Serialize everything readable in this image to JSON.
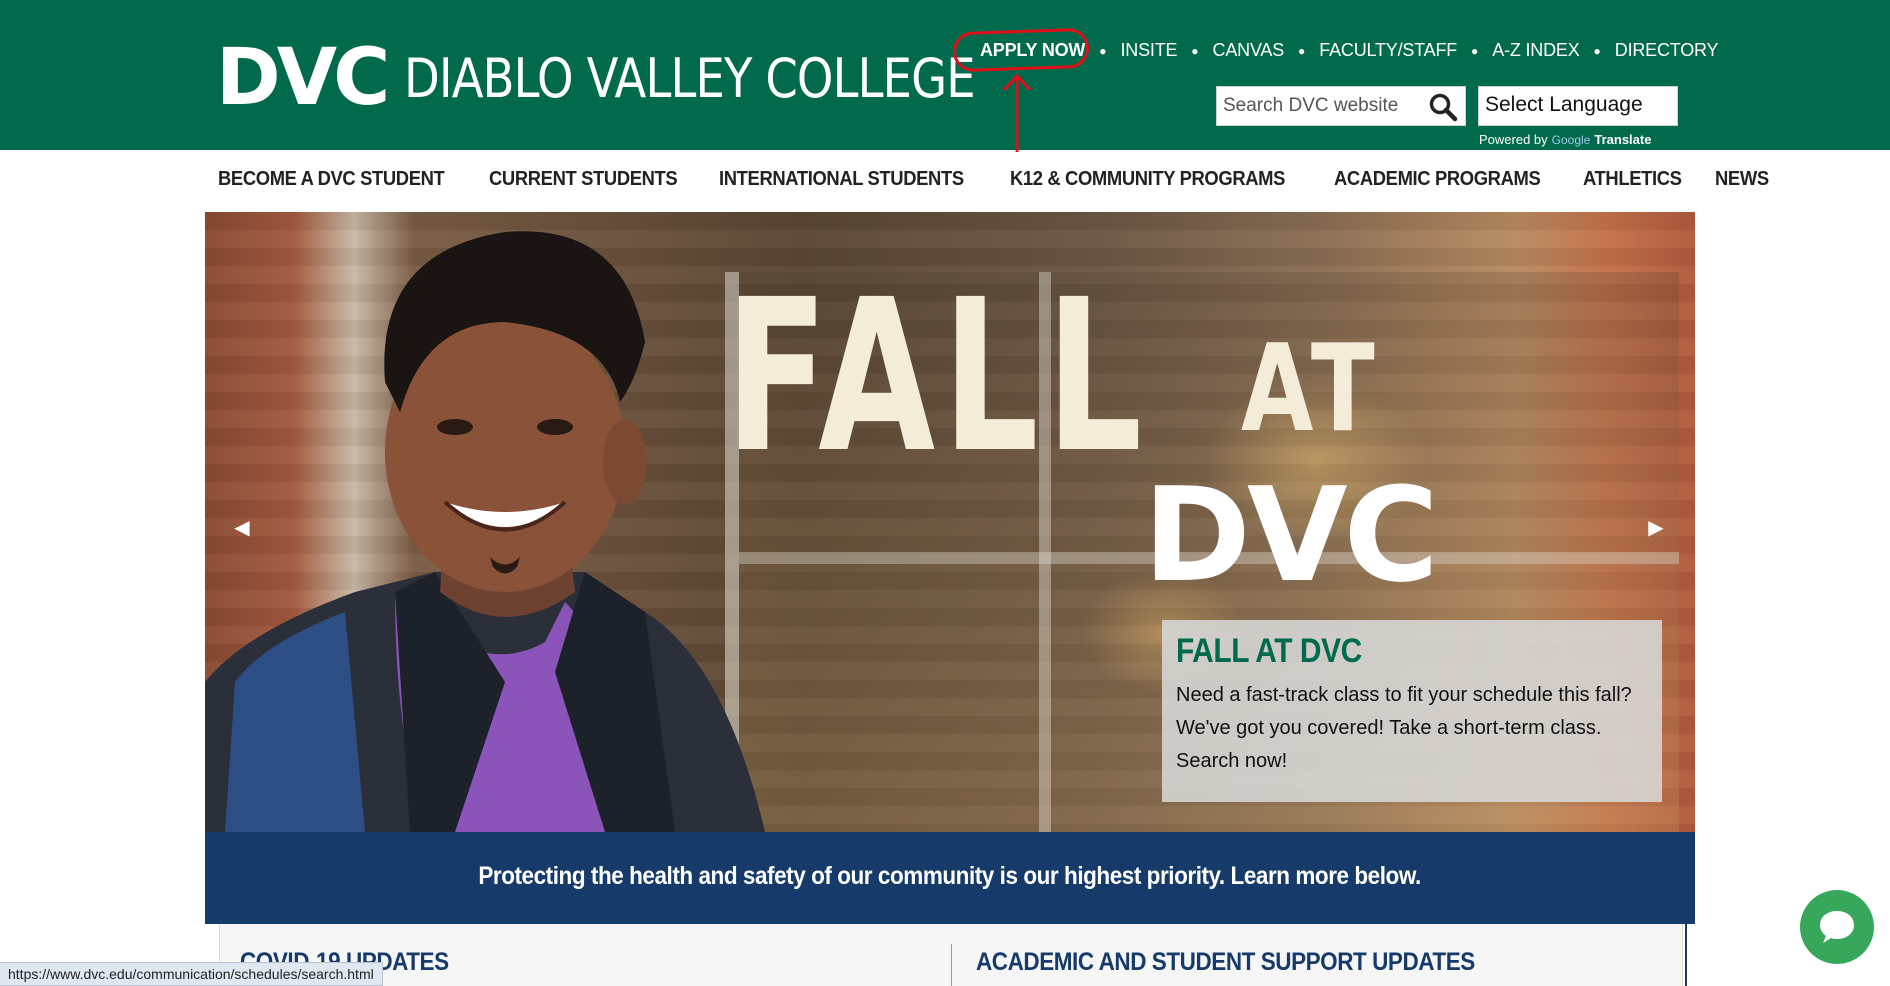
{
  "header": {
    "logo_mark": "DVC",
    "logo_name": "DIABLO VALLEY COLLEGE",
    "bg_color": "#016a4d",
    "utility_links": [
      "APPLY NOW",
      "INSITE",
      "CANVAS",
      "FACULTY/STAFF",
      "A-Z INDEX",
      "DIRECTORY"
    ],
    "search": {
      "placeholder": "Search DVC website",
      "icon": "search-icon"
    },
    "language_select": "Select Language",
    "powered_by": {
      "prefix": "Powered by",
      "google": "Google",
      "translate": "Translate"
    }
  },
  "nav": {
    "items": [
      "BECOME A DVC STUDENT",
      "CURRENT STUDENTS",
      "INTERNATIONAL STUDENTS",
      "K12 & COMMUNITY PROGRAMS",
      "ACADEMIC PROGRAMS",
      "ATHLETICS",
      "NEWS"
    ]
  },
  "hero": {
    "headline_fall": "FALL",
    "headline_at": "AT",
    "headline_dvc": "DVC",
    "caption_title": "FALL AT DVC",
    "caption_text": "Need a fast-track class to fit your schedule this fall? We've got you covered! Take a short-term class. Search now!",
    "prev_icon": "triangle-left-icon",
    "next_icon": "triangle-right-icon"
  },
  "banner": {
    "text": "Protecting the health and safety of our community is our highest priority. Learn more below.",
    "bg_color": "#163b6b"
  },
  "panels": {
    "left_title": "COVID-19 UPDATES",
    "right_title": "ACADEMIC AND STUDENT SUPPORT UPDATES"
  },
  "annotation": {
    "color": "#e0101a"
  },
  "chat": {
    "icon": "chat-bubble-icon",
    "color": "#37a85b"
  },
  "status_bar": {
    "url": "https://www.dvc.edu/communication/schedules/search.html"
  }
}
